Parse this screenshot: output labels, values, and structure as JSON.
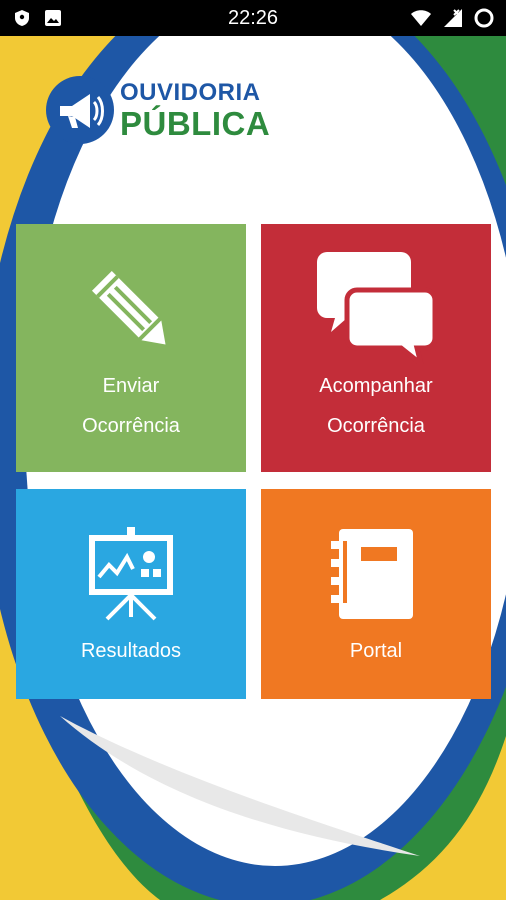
{
  "status_bar": {
    "time": "22:26",
    "icons": [
      "shield-icon",
      "image-icon",
      "wifi-icon",
      "signal-icon",
      "battery-icon"
    ]
  },
  "logo": {
    "line1": "OUVIDORIA",
    "line2": "PÚBLICA",
    "icon": "megaphone-icon"
  },
  "colors": {
    "blue": "#1e57a6",
    "green": "#2e8b3e",
    "yellow": "#f2c935",
    "tile_enviar": "#84b55e",
    "tile_acompanhar": "#c32d39",
    "tile_resultados": "#2aa7e1",
    "tile_portal": "#f07822"
  },
  "menu": {
    "enviar": {
      "line1": "Enviar",
      "line2": "Ocorrência",
      "icon": "pencil-icon"
    },
    "acompanhar": {
      "line1": "Acompanhar",
      "line2": "Ocorrência",
      "icon": "chat-bubbles-icon"
    },
    "resultados": {
      "label": "Resultados",
      "icon": "presentation-chart-icon"
    },
    "portal": {
      "label": "Portal",
      "icon": "notebook-icon"
    }
  }
}
